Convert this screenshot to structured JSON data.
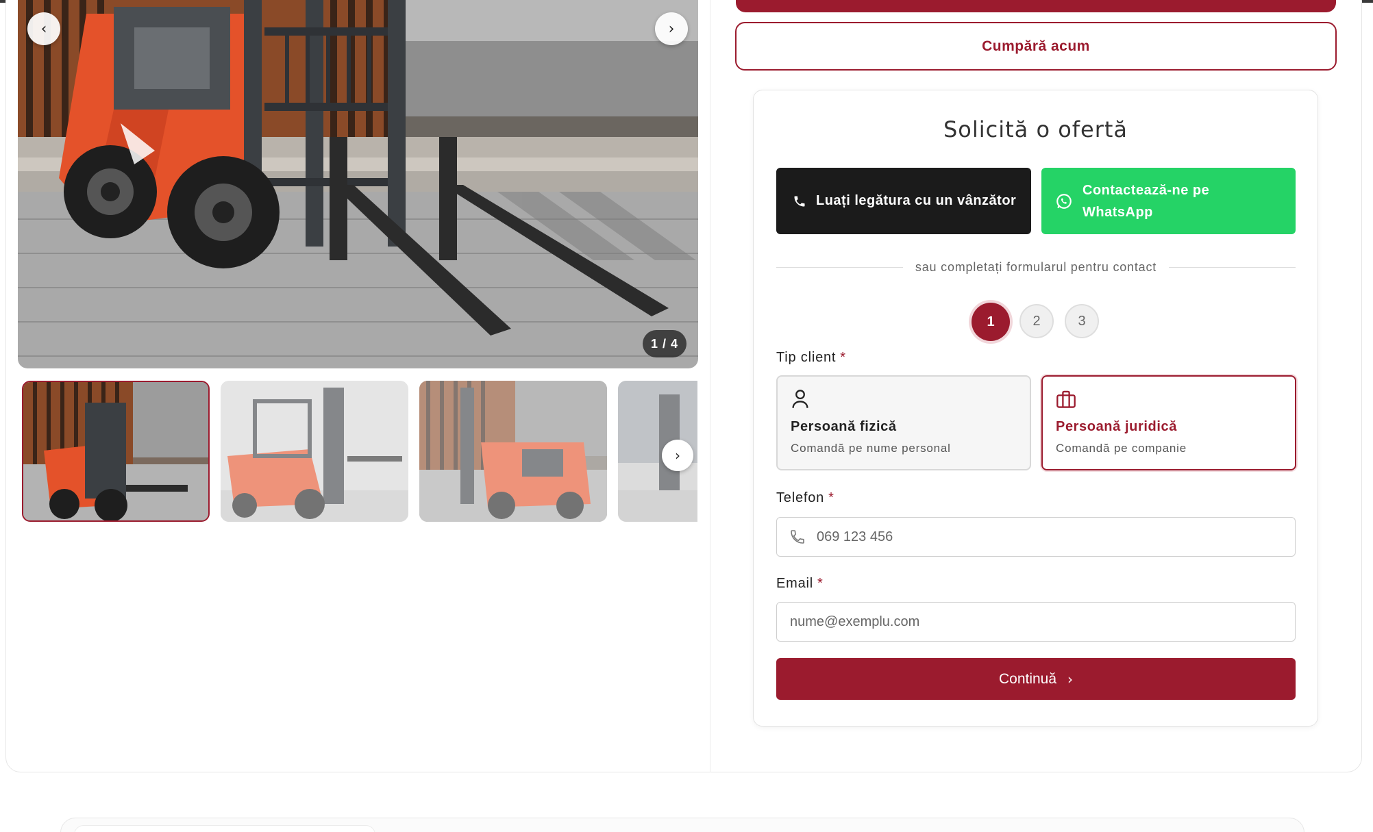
{
  "gallery": {
    "counter": "1 / 4",
    "prev_icon": "chevron-left-icon",
    "next_icon": "chevron-right-icon",
    "prev_glyph": "‹",
    "next_glyph": "›",
    "thumbnails": [
      "forklift-front-view",
      "forklift-side-view",
      "forklift-rear-view",
      "forklift-partial-view"
    ]
  },
  "actions": {
    "buy_now": "Cumpără acum"
  },
  "offer": {
    "title": "Solicită o ofertă",
    "contact_seller": "Luați legătura cu un vânzător",
    "whatsapp_line1": "Contactează-ne pe",
    "whatsapp_line2": "WhatsApp",
    "divider_text": "sau completați formularul pentru contact",
    "steps": [
      "1",
      "2",
      "3"
    ],
    "active_step": 1,
    "client_type_label": "Tip client",
    "required_mark": "*",
    "client_options": [
      {
        "title": "Persoană fizică",
        "subtitle": "Comandă pe nume personal",
        "icon": "user-icon",
        "selected": false
      },
      {
        "title": "Persoană juridică",
        "subtitle": "Comandă pe companie",
        "icon": "briefcase-icon",
        "selected": true
      }
    ],
    "phone_label": "Telefon",
    "phone_placeholder": "069 123 456",
    "email_label": "Email",
    "email_placeholder": "nume@exemplu.com",
    "continue": "Continuă",
    "continue_glyph": "›"
  },
  "colors": {
    "brand": "#9b1b2e",
    "whatsapp": "#25d366",
    "dark_button": "#1b1b1b"
  }
}
